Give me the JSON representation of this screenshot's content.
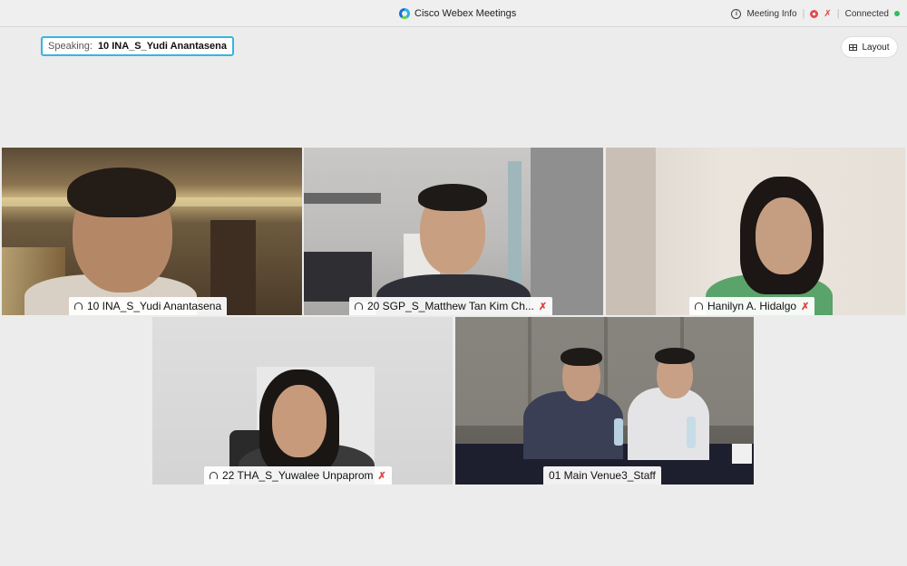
{
  "titlebar": {
    "app_title": "Cisco Webex Meetings",
    "meeting_info_label": "Meeting Info",
    "status_label": "Connected"
  },
  "speaking": {
    "label": "Speaking:",
    "name": "10 INA_S_Yudi Anantasena"
  },
  "layout_button": {
    "label": "Layout"
  },
  "participants": [
    {
      "name": "10 INA_S_Yudi Anantasena",
      "active_speaker": true,
      "muted": false
    },
    {
      "name": "20 SGP_S_Matthew Tan Kim Ch...",
      "active_speaker": false,
      "muted": true
    },
    {
      "name": "Hanilyn A. Hidalgo",
      "active_speaker": false,
      "muted": true
    },
    {
      "name": "22 THA_S_Yuwalee Unpaprom",
      "active_speaker": false,
      "muted": true
    },
    {
      "name": "01 Main Venue3_Staff",
      "active_speaker": false,
      "muted": false
    }
  ],
  "colors": {
    "accent": "#35b6e0",
    "muted": "#e0453e",
    "connected": "#2ec05a"
  },
  "icons": {
    "logo": "webex-logo-icon",
    "info": "info-icon",
    "record": "record-icon",
    "mute": "microphone-muted-icon",
    "layout": "grid-layout-icon",
    "headset": "headset-icon"
  }
}
